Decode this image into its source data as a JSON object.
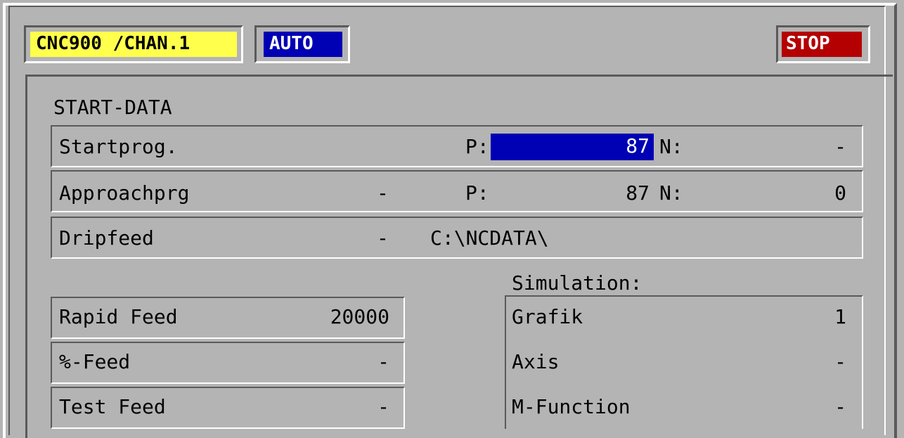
{
  "header": {
    "channel_label": "CNC900 /CHAN.1",
    "mode_label": "AUTO",
    "status_label": "STOP",
    "colors": {
      "channel_bg": "#ffff4c",
      "mode_bg": "#0000b4",
      "status_bg": "#b40000"
    }
  },
  "start_data": {
    "title": "START-DATA",
    "startprog": {
      "label": "Startprog.",
      "p_label": "P:",
      "p_value": "87",
      "n_label": "N:",
      "n_value": "-"
    },
    "approachprg": {
      "label": "Approachprg",
      "flag": "-",
      "p_label": "P:",
      "p_value": "87",
      "n_label": "N:",
      "n_value": "0"
    },
    "dripfeed": {
      "label": "Dripfeed",
      "flag": "-",
      "path": "C:\\NCDATA\\"
    }
  },
  "feeds": [
    {
      "label": "Rapid Feed",
      "value": "20000"
    },
    {
      "label": "%-Feed",
      "value": "-"
    },
    {
      "label": "Test Feed",
      "value": "-"
    }
  ],
  "simulation": {
    "title": "Simulation:",
    "items": [
      {
        "label": "Grafik",
        "value": "1"
      },
      {
        "label": "Axis",
        "value": "-"
      },
      {
        "label": "M-Function",
        "value": "-"
      }
    ]
  }
}
